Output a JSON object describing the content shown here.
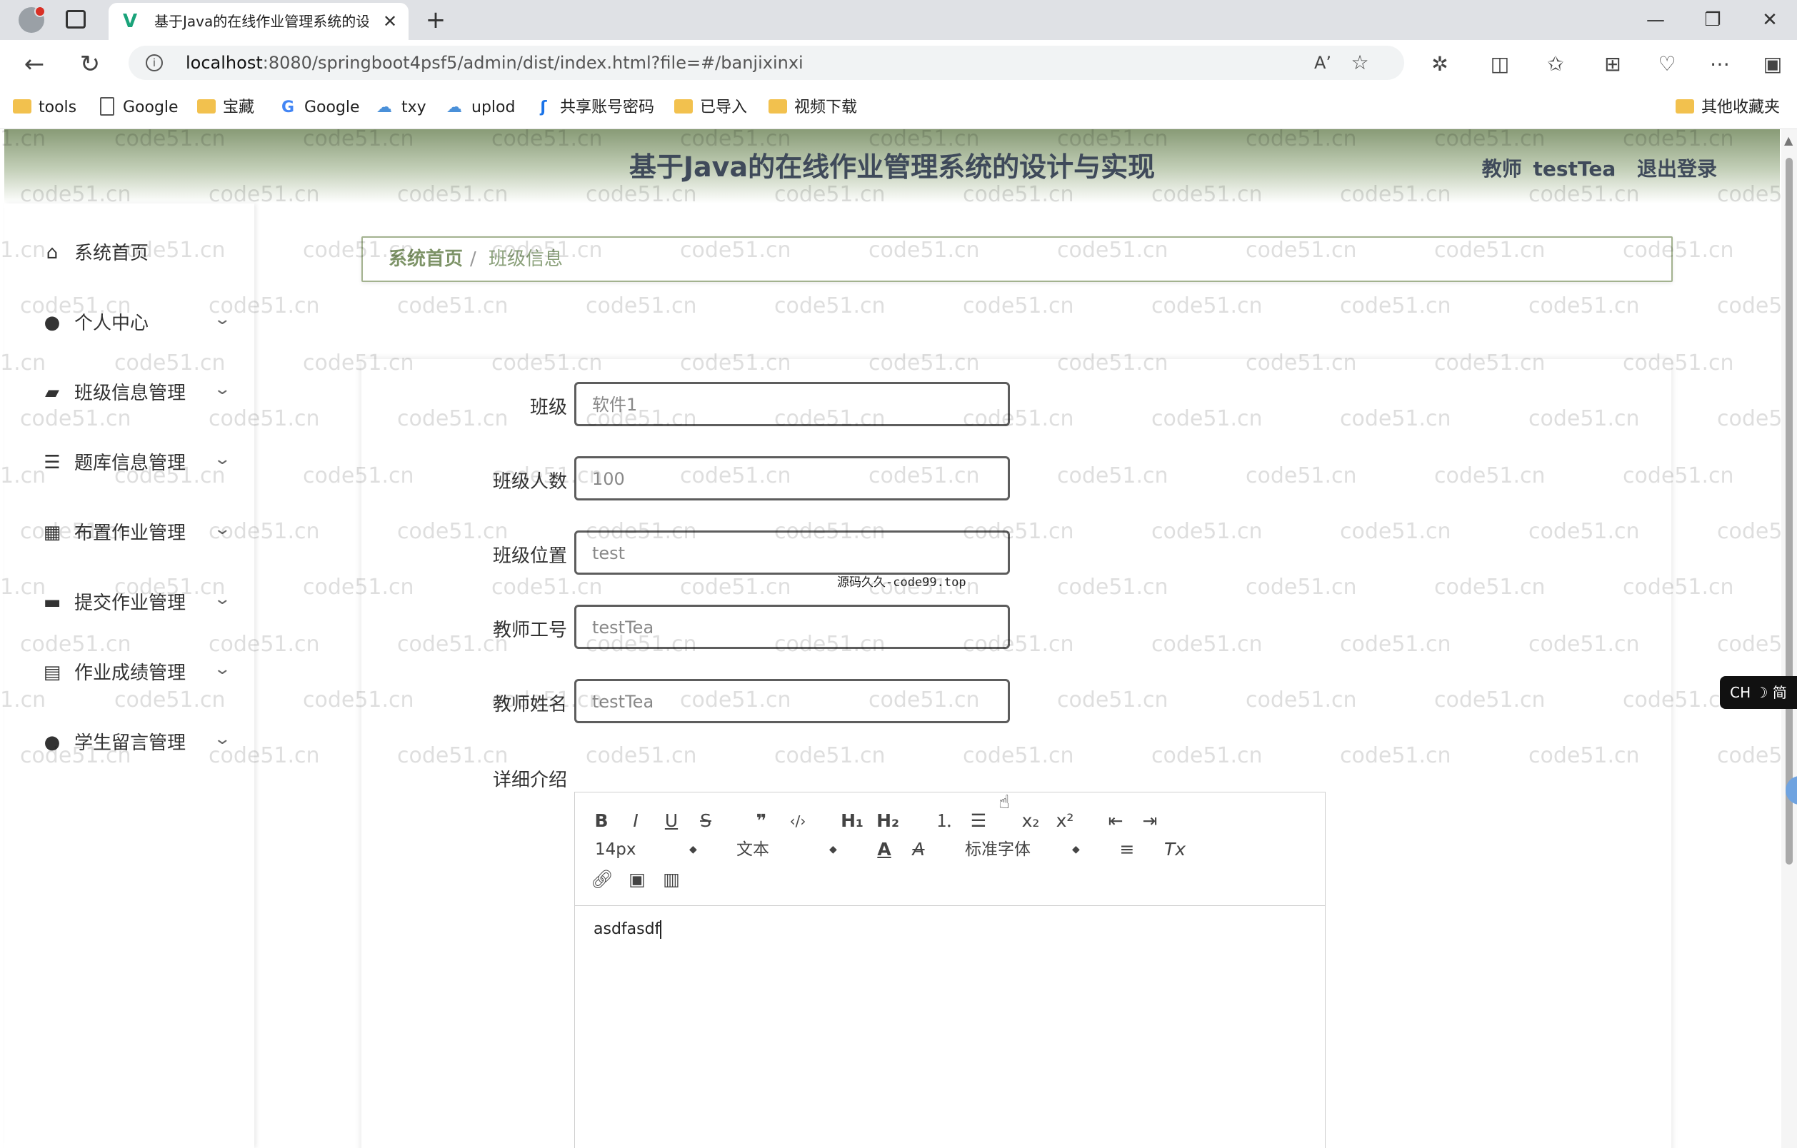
{
  "browser": {
    "tab_title": "基于Java的在线作业管理系统的设计与实现",
    "tab_favicon": "V",
    "tab_close": "✕",
    "new_tab": "+",
    "window_controls": {
      "minimize": "—",
      "restore": "❐",
      "close": "✕"
    },
    "url_host": "localhost",
    "url_rest": ":8080/springboot4psf5/admin/dist/index.html?file=#/banjixinxi",
    "icons": {
      "back": "arrow-left-icon",
      "refresh": "refresh-icon",
      "info": "info-icon",
      "read_aloud": "read-aloud-icon",
      "favorite": "star-icon",
      "extensions": "puzzle-icon",
      "split": "split-screen-icon",
      "favorites": "favorites-icon",
      "collections": "collections-icon",
      "health": "heart-icon",
      "menu": "ellipsis-icon",
      "sidebar": "sidebar-icon"
    },
    "glyphs": {
      "back": "←",
      "refresh": "↻",
      "info": "i",
      "read": "Aʼ",
      "star": "☆",
      "ext": "✲",
      "split": "◫",
      "favs": "✩",
      "coll": "⊞",
      "health": "♡",
      "menu": "⋯",
      "side": "▣"
    }
  },
  "bookmarks": [
    {
      "label": "tools",
      "icon": "folder"
    },
    {
      "label": "Google",
      "icon": "page"
    },
    {
      "label": "宝藏",
      "icon": "folder"
    },
    {
      "label": "Google",
      "icon": "google"
    },
    {
      "label": "txy",
      "icon": "cloud"
    },
    {
      "label": "uplod",
      "icon": "cloud"
    },
    {
      "label": "共享账号密码",
      "icon": "bookmark"
    },
    {
      "label": "已导入",
      "icon": "folder"
    },
    {
      "label": "视频下载",
      "icon": "folder"
    },
    {
      "label": "其他收藏夹",
      "icon": "folder"
    }
  ],
  "header": {
    "title": "基于Java的在线作业管理系统的设计与实现",
    "user_role": "教师",
    "username": "testTea",
    "logout": "退出登录"
  },
  "sidebar": {
    "items": [
      {
        "label": "系统首页",
        "icon": "home-icon",
        "glyph": "⌂"
      },
      {
        "label": "个人中心",
        "icon": "user-icon",
        "glyph": "●"
      },
      {
        "label": "班级信息管理",
        "icon": "wallet-icon",
        "glyph": "▰"
      },
      {
        "label": "题库信息管理",
        "icon": "list-icon",
        "glyph": "☰"
      },
      {
        "label": "布置作业管理",
        "icon": "grid-icon",
        "glyph": "▦"
      },
      {
        "label": "提交作业管理",
        "icon": "tray-icon",
        "glyph": "▬"
      },
      {
        "label": "作业成绩管理",
        "icon": "clipboard-icon",
        "glyph": "▤"
      },
      {
        "label": "学生留言管理",
        "icon": "bulb-icon",
        "glyph": "●"
      }
    ],
    "chevron": "⌄"
  },
  "breadcrumb": {
    "home": "系统首页",
    "separator": "/",
    "current": "班级信息"
  },
  "form": {
    "fields": [
      {
        "label": "班级",
        "value": "软件1"
      },
      {
        "label": "班级人数",
        "value": "100"
      },
      {
        "label": "班级位置",
        "value": "test"
      },
      {
        "label": "教师工号",
        "value": "testTea"
      },
      {
        "label": "教师姓名",
        "value": "testTea"
      }
    ],
    "detail_label": "详细介绍"
  },
  "editor": {
    "buttons": {
      "bold": "B",
      "italic": "I",
      "underline": "U",
      "strike": "S",
      "quote": "❞",
      "code": "‹/›",
      "h1": "H₁",
      "h2": "H₂",
      "ol": "⒈",
      "ul": "☰",
      "sub": "x₂",
      "sup": "x²",
      "outdent": "⇤",
      "indent": "⇥",
      "align": "≡",
      "clear": "Tx",
      "font_color": "A",
      "bg_color": "A",
      "link": "🔗︎",
      "image": "▣",
      "video": "▥"
    },
    "size_select": "14px",
    "header_select": "文本",
    "font_select": "标准字体",
    "select_arrows": "◆",
    "content": "asdfasdf"
  },
  "overlay_text": "源码久久-code99.top",
  "ime": "CH ☽ 简",
  "watermark": "code51.cn",
  "watermark_partial": "1.cn",
  "watermark_left": "code"
}
